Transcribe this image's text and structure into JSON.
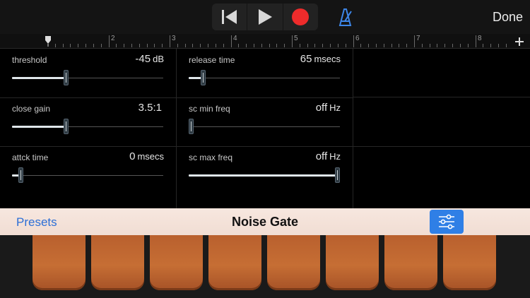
{
  "toolbar": {
    "done_label": "Done"
  },
  "ruler": {
    "bars": [
      "2",
      "3",
      "4",
      "5",
      "6",
      "7",
      "8"
    ]
  },
  "params": [
    {
      "label": "threshold",
      "value": "-45",
      "unit": "dB",
      "level": 0.36
    },
    {
      "label": "release time",
      "value": "65",
      "unit": "msecs",
      "level": 0.1
    },
    {
      "label": "close gain",
      "value": "3.5:1",
      "unit": "",
      "level": 0.36
    },
    {
      "label": "sc min freq",
      "value": "off",
      "unit": "Hz",
      "level": 0.0
    },
    {
      "label": "attck time",
      "value": "0",
      "unit": "msecs",
      "level": 0.06
    },
    {
      "label": "sc max freq",
      "value": "off",
      "unit": "Hz",
      "level": 1.0
    }
  ],
  "preset_bar": {
    "presets_label": "Presets",
    "title": "Noise Gate"
  },
  "colors": {
    "accent": "#2f7fe6",
    "record": "#ee2b2b",
    "pad": "#c66e34"
  }
}
